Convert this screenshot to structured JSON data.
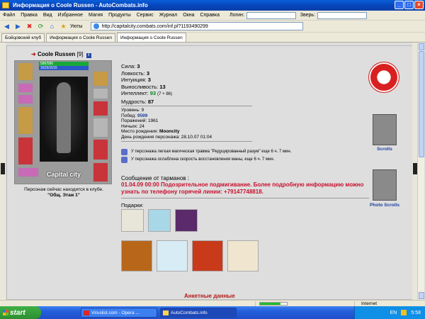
{
  "window": {
    "title": "Информация о Coole Russen - AutoCombats.info"
  },
  "menu": {
    "items": [
      "Файл",
      "Правка",
      "Вид",
      "Избранное",
      "Магия",
      "Продукты",
      "Сервис",
      "Журнал",
      "Окна",
      "Справка"
    ],
    "login_label": "Логин:",
    "beast_label": "Зверь:"
  },
  "toolbar": {
    "favorites_label": "Уюты",
    "address": "http://capitalcity.combats.com/inf.pl?1193490299"
  },
  "tabs": [
    "Бойцовский клуб",
    "Информация о Coole Russen",
    "Информация о Coole Russen"
  ],
  "character": {
    "name": "Coole Russen",
    "level": "[9]",
    "hp": "586/586",
    "mp": "1615/1615",
    "city": "Capital city",
    "location_line1": "Персонаж сейчас находится в клубе.",
    "location_line2": "\"Общ. Этаж 1\""
  },
  "stats": [
    {
      "label": "Сила:",
      "value": "3",
      "extra": ""
    },
    {
      "label": "Ловкость:",
      "value": "3",
      "extra": ""
    },
    {
      "label": "Интуиция:",
      "value": "3",
      "extra": ""
    },
    {
      "label": "Выносливость:",
      "value": "13",
      "extra": ""
    },
    {
      "label": "Интеллект:",
      "value": "93",
      "extra": "(7 + 86)"
    },
    {
      "label": "Мудрость:",
      "value": "87",
      "extra": ""
    }
  ],
  "details": [
    {
      "label": "Уровень:",
      "value": "9"
    },
    {
      "label": "Побед:",
      "value": "9599"
    },
    {
      "label": "Поражений:",
      "value": "1961"
    },
    {
      "label": "Ничьих:",
      "value": "24"
    },
    {
      "label": "Место рождения:",
      "value": "Mooncity"
    },
    {
      "label": "День рождения персонажа:",
      "value": "28.10.07 01:04"
    }
  ],
  "effects": [
    "У персонажа легкая магическая травма \"Редуцированный разум\" еще 6 ч. 7 мин.",
    "У персонажа ослаблена скорость восстановления маны, еще 6 ч. 7 мин."
  ],
  "message": {
    "title": "Сообщение от тарманов :",
    "text": "01.04.09 00:00 Подозрительное подмигивание. Более подробную информацию можно узнать по телефону горячей линии: +79147748818."
  },
  "gifts": {
    "title": "Подарки:"
  },
  "anketa_label": "Анкетные данные",
  "side": {
    "scrolls_label": "Scrolls",
    "photo_label": "Photo Scrolls"
  },
  "status": {
    "internet_label": "Internet",
    "progress": 0.75
  },
  "taskbar": {
    "start_label": "start",
    "tasks": [
      "Viruslist.com - Opera ...",
      "AutoCombats.info"
    ],
    "lang": "EN",
    "time": "5:58"
  },
  "colors": {
    "message": "#c8102e",
    "titlebar": "#0542b8",
    "hp": "#1aa83a",
    "mp": "#2b57c7"
  }
}
